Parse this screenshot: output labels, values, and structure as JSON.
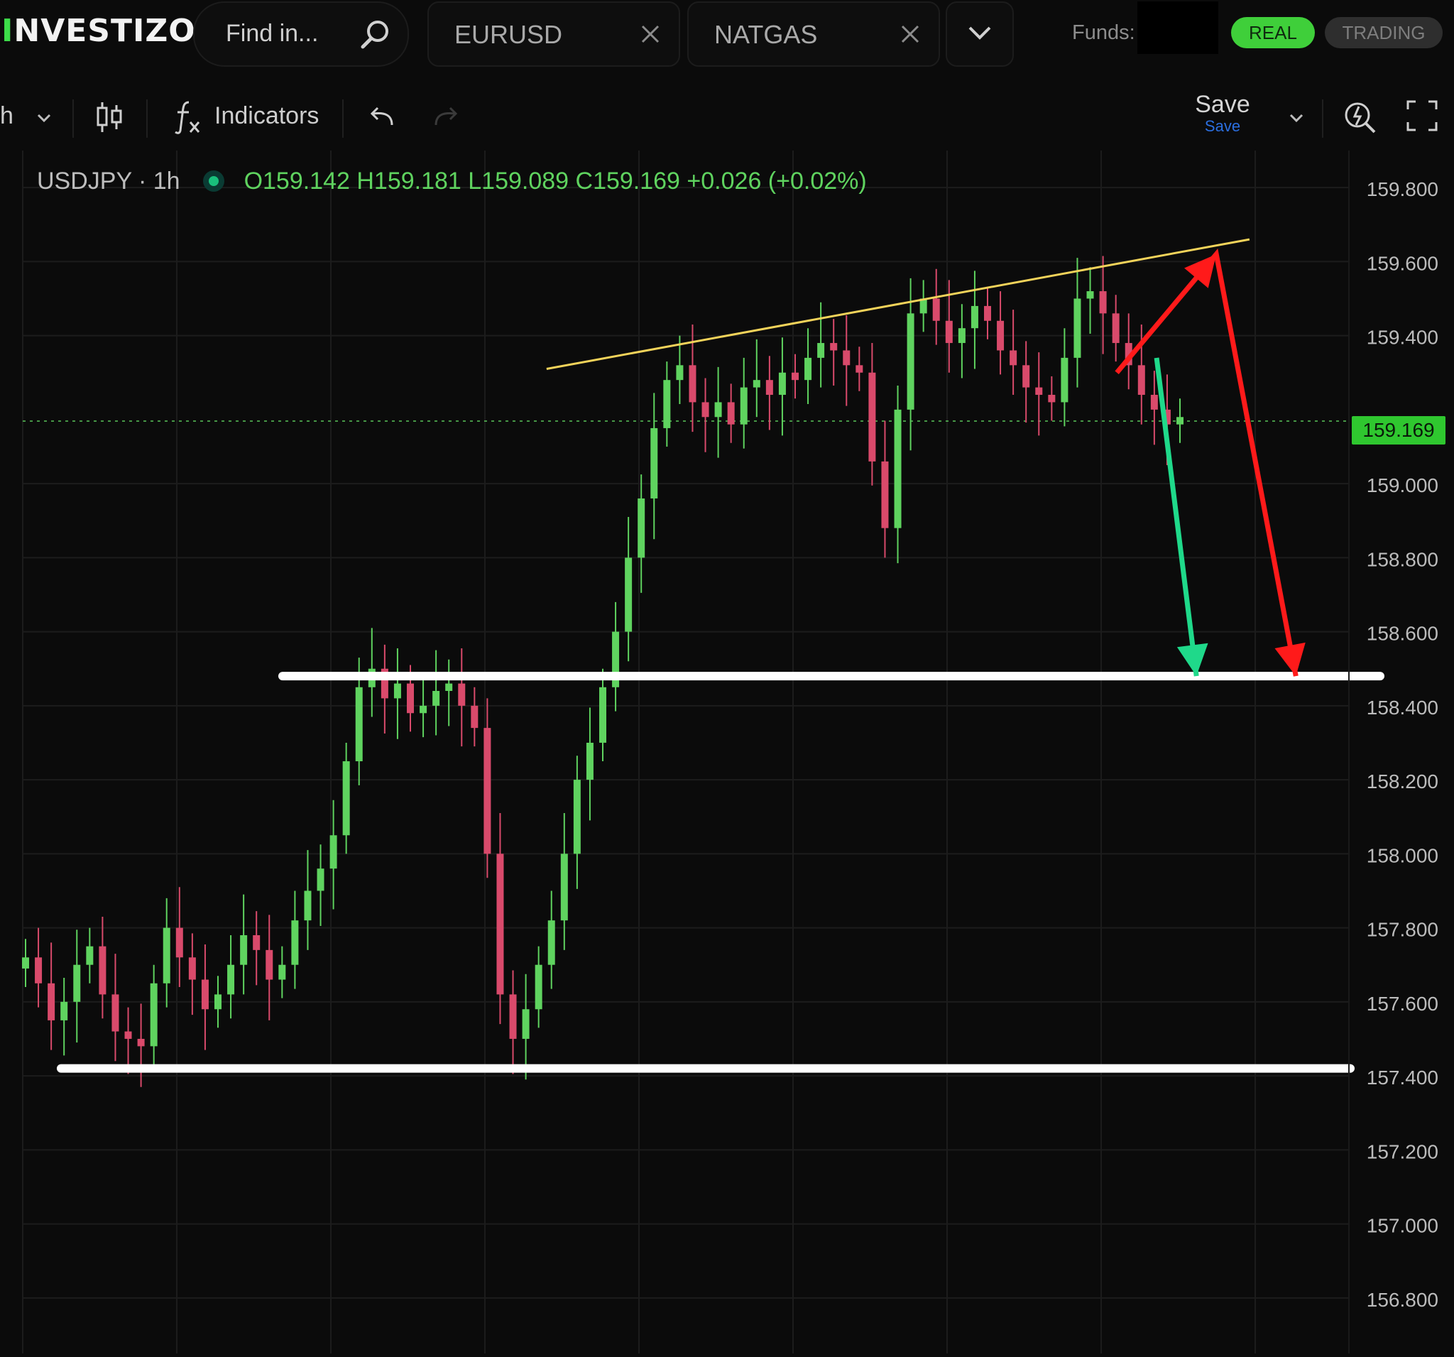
{
  "app": {
    "logo_first": "I",
    "logo_rest": "NVESTIZO"
  },
  "header": {
    "search_placeholder": "Find in...",
    "tabs": [
      {
        "label": "EURUSD"
      },
      {
        "label": "NATGAS"
      }
    ],
    "funds_label": "Funds:",
    "mode_buttons": {
      "real": "REAL",
      "trading": "TRADING"
    }
  },
  "toolbar": {
    "interval_fragment": "h",
    "indicators_label": "Indicators",
    "save_label": "Save",
    "save_sub_label": "Save"
  },
  "legend": {
    "symbol": "USDJPY · 1h",
    "ohlc_text": "O159.142 H159.181 L159.089 C159.169 +0.026 (+0.02%)"
  },
  "colors": {
    "background": "#0b0b0b",
    "grid": "#1c1c1c",
    "up_candle": "#5fd35f",
    "down_candle": "#d94a6b",
    "trendline": "#f2d35a",
    "support": "#ffffff",
    "arrow_red": "#ff1a1a",
    "arrow_green": "#1fd98a",
    "real_button": "#3fcf3a",
    "price_tag": "#2fc72f",
    "save_sub": "#2b6fe0"
  },
  "chart_data": {
    "type": "candlestick",
    "symbol": "USDJPY",
    "interval": "1h",
    "current_price": 159.169,
    "current_price_label": "159.169",
    "ylim": [
      156.65,
      159.9
    ],
    "y_ticks": [
      "159.800",
      "159.600",
      "159.400",
      "159.000",
      "158.800",
      "158.600",
      "158.400",
      "158.200",
      "158.000",
      "157.800",
      "157.600",
      "157.400",
      "157.200",
      "157.000",
      "156.800"
    ],
    "candles_approx_close": [
      157.72,
      157.65,
      157.55,
      157.6,
      157.7,
      157.75,
      157.62,
      157.52,
      157.5,
      157.48,
      157.65,
      157.8,
      157.72,
      157.66,
      157.58,
      157.62,
      157.7,
      157.78,
      157.74,
      157.66,
      157.7,
      157.82,
      157.9,
      157.96,
      158.05,
      158.25,
      158.45,
      158.5,
      158.42,
      158.46,
      158.38,
      158.4,
      158.44,
      158.46,
      158.4,
      158.34,
      158.0,
      157.62,
      157.5,
      157.58,
      157.7,
      157.82,
      158.0,
      158.2,
      158.3,
      158.45,
      158.6,
      158.8,
      158.96,
      159.15,
      159.28,
      159.32,
      159.22,
      159.18,
      159.22,
      159.16,
      159.26,
      159.28,
      159.24,
      159.3,
      159.28,
      159.34,
      159.38,
      159.36,
      159.32,
      159.3,
      159.06,
      158.88,
      159.2,
      159.46,
      159.5,
      159.44,
      159.38,
      159.42,
      159.48,
      159.44,
      159.36,
      159.32,
      159.26,
      159.24,
      159.22,
      159.34,
      159.5,
      159.52,
      159.46,
      159.38,
      159.32,
      159.24,
      159.2,
      159.16,
      159.18
    ],
    "drawings": {
      "trendline": {
        "from": [
          0.395,
          159.31
        ],
        "to": [
          0.925,
          159.66
        ]
      },
      "support_lines": [
        158.48,
        157.42
      ],
      "arrows": [
        {
          "color": "red",
          "path": [
            [
              0.825,
              159.3
            ],
            [
              0.9,
              159.62
            ],
            [
              0.96,
              158.48
            ]
          ]
        },
        {
          "color": "green",
          "path": [
            [
              0.855,
              159.34
            ],
            [
              0.885,
              158.48
            ]
          ]
        }
      ]
    }
  }
}
